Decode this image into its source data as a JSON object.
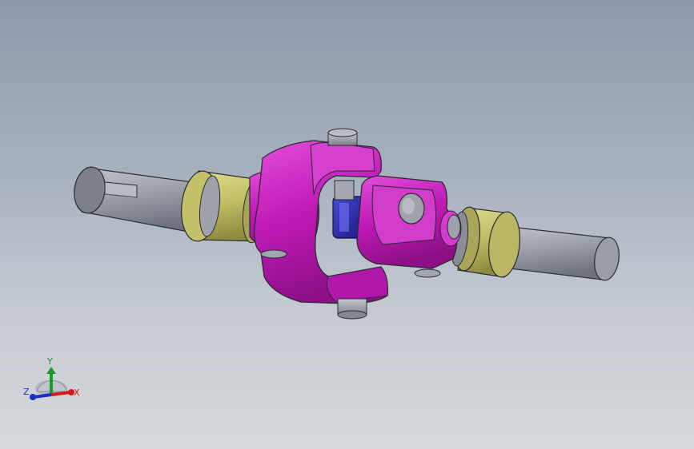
{
  "viewport": {
    "background_top": "#8d9aac",
    "background_bottom": "#d6d8db"
  },
  "model": {
    "parts": [
      {
        "name": "left-shaft",
        "color": "#9ea1ab"
      },
      {
        "name": "left-bushing",
        "color": "#c4c269"
      },
      {
        "name": "yoke",
        "color": "#c21ab8"
      },
      {
        "name": "cross-spider",
        "color": "#2a2aa0"
      },
      {
        "name": "pin",
        "color": "#a3a6ae"
      },
      {
        "name": "right-bushing",
        "color": "#b9b664"
      },
      {
        "name": "right-shaft",
        "color": "#9c9fa8"
      }
    ]
  },
  "triad": {
    "x_label": "X",
    "y_label": "Y",
    "z_label": "Z",
    "x_color": "#d21c1c",
    "y_color": "#1a9a26",
    "z_color": "#1b2fc4"
  }
}
